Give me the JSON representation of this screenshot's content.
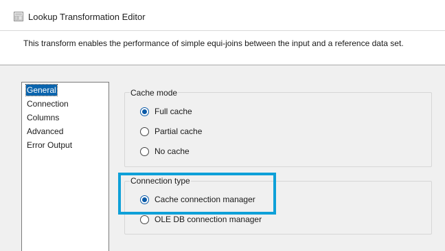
{
  "window": {
    "title": "Lookup Transformation Editor",
    "icon": "window-app-icon"
  },
  "description": "This transform enables the performance of simple equi-joins between the input and a reference data set.",
  "nav": {
    "items": [
      {
        "label": "General",
        "selected": true
      },
      {
        "label": "Connection",
        "selected": false
      },
      {
        "label": "Columns",
        "selected": false
      },
      {
        "label": "Advanced",
        "selected": false
      },
      {
        "label": "Error Output",
        "selected": false
      }
    ]
  },
  "cache_mode": {
    "legend": "Cache mode",
    "options": [
      {
        "label": "Full cache",
        "checked": true
      },
      {
        "label": "Partial cache",
        "checked": false
      },
      {
        "label": "No cache",
        "checked": false
      }
    ]
  },
  "connection_type": {
    "legend": "Connection type",
    "options": [
      {
        "label": "Cache connection manager",
        "checked": true
      },
      {
        "label": "OLE DB connection manager",
        "checked": false
      }
    ]
  },
  "colors": {
    "accent": "#0a64ad",
    "highlight_border": "#0ea0d8"
  }
}
